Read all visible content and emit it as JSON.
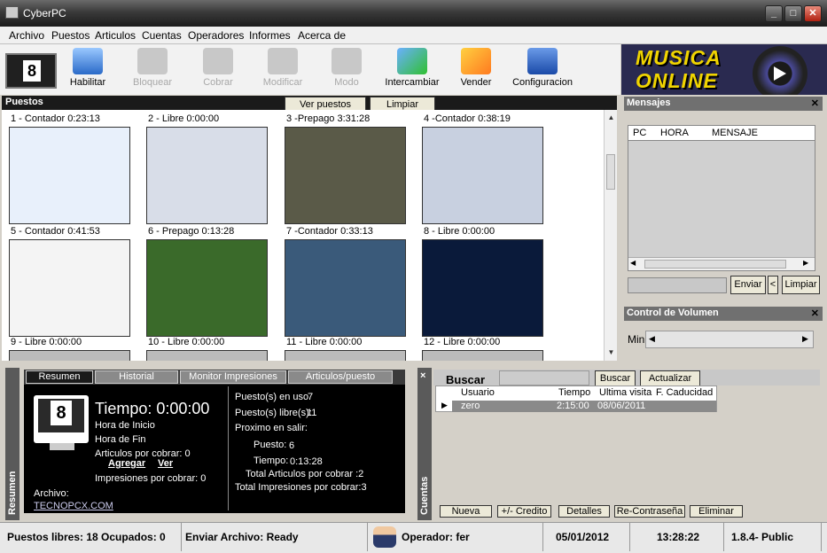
{
  "window": {
    "title": "CyberPC"
  },
  "menu": [
    "Archivo",
    "Puestos",
    "Articulos",
    "Cuentas",
    "Operadores",
    "Informes",
    "Acerca de"
  ],
  "toolbar": {
    "logo_number": "8",
    "buttons": [
      {
        "label": "Habilitar",
        "icon": "computer-icon",
        "enabled": true
      },
      {
        "label": "Bloquear",
        "icon": "lock-computer-icon",
        "enabled": false
      },
      {
        "label": "Cobrar",
        "icon": "cash-icon",
        "enabled": false
      },
      {
        "label": "Modificar",
        "icon": "edit-icon",
        "enabled": false
      },
      {
        "label": "Modo",
        "icon": "mode-icon",
        "enabled": false
      },
      {
        "label": "Intercambiar",
        "icon": "swap-icon",
        "enabled": true
      },
      {
        "label": "Vender",
        "icon": "sell-icon",
        "enabled": true
      },
      {
        "label": "Configuracion",
        "icon": "settings-icon",
        "enabled": true
      }
    ]
  },
  "banner": {
    "line1": "MUSICA",
    "line2": "ONLINE"
  },
  "puestos": {
    "title": "Puestos",
    "ver_puestos": "Ver puestos",
    "limpiar": "Limpiar",
    "items": [
      {
        "label": "1 - Contador 0:23:13",
        "thumb": "#e8f0fb"
      },
      {
        "label": "2 - Libre 0:00:00",
        "thumb": "#d8dde8"
      },
      {
        "label": "3 -Prepago 3:31:28",
        "thumb": "#5a5a48"
      },
      {
        "label": "4 -Contador 0:38:19",
        "thumb": "#c8d0e0"
      },
      {
        "label": "5 - Contador 0:41:53",
        "thumb": "#f4f4f4"
      },
      {
        "label": "6 - Prepago 0:13:28",
        "thumb": "#3a6a2a"
      },
      {
        "label": "7 -Contador 0:33:13",
        "thumb": "#3a5a7a"
      },
      {
        "label": "8 - Libre 0:00:00",
        "thumb": "#0a1a3a"
      },
      {
        "label": "9 - Libre 0:00:00",
        "thumb": "#bbbbbb"
      },
      {
        "label": "10 - Libre 0:00:00",
        "thumb": "#bbbbbb"
      },
      {
        "label": "11 - Libre 0:00:00",
        "thumb": "#bbbbbb"
      },
      {
        "label": "12 - Libre 0:00:00",
        "thumb": "#bbbbbb"
      }
    ]
  },
  "mensajes": {
    "title": "Mensajes",
    "columns": [
      "PC",
      "HORA",
      "MENSAJE"
    ],
    "enviar": "Enviar",
    "back": "<",
    "limpiar": "Limpiar"
  },
  "volumen": {
    "title": "Control de Volumen",
    "min_label": "Min"
  },
  "resumen": {
    "side_label": "Resumen",
    "tabs": [
      "Resumen",
      "Historial",
      "Monitor Impresiones",
      "Articulos/puesto"
    ],
    "monitor_number": "8",
    "tiempo": "Tiempo: 0:00:00",
    "hora_inicio": "Hora de Inicio",
    "hora_fin": "Hora de Fin",
    "articulos_cobrar": "Articulos por cobrar: 0",
    "agregar": "Agregar",
    "ver": "Ver",
    "impresiones_cobrar": "Impresiones por cobrar: 0",
    "archivo": "Archivo:",
    "link": "TECNOPCX.COM",
    "en_uso_label": "Puesto(s) en uso",
    "en_uso": "7",
    "libres_label": "Puesto(s) libre(s):",
    "libres": "11",
    "proximo": "Proximo en salir:",
    "puesto_label": "Puesto:",
    "puesto": "6",
    "tiempo_label": "Tiempo:",
    "tiempo_val": "0:13:28",
    "total_art": "Total Articulos por cobrar :2",
    "total_imp": "Total Impresiones por cobrar:3"
  },
  "cuentas": {
    "side_label": "Cuentas",
    "close": "×",
    "buscar_label": "Buscar",
    "buscar_btn": "Buscar",
    "actualizar_btn": "Actualizar",
    "columns": [
      "Usuario",
      "Tiempo",
      "Ultima visita",
      "F. Caducidad"
    ],
    "rows": [
      {
        "usuario": "zero",
        "tiempo": "2:15:00",
        "ultima": "08/06/2011",
        "caducidad": ""
      }
    ],
    "actions": [
      "Nueva",
      "+/- Credito",
      "Detalles",
      "Re-Contraseña",
      "Eliminar"
    ]
  },
  "status": {
    "puestos": "Puestos libres: 18 Ocupados: 0",
    "archivo": "Enviar Archivo: Ready",
    "operador": "Operador: fer",
    "fecha": "05/01/2012",
    "hora": "13:28:22",
    "version": "1.8.4- Public"
  }
}
